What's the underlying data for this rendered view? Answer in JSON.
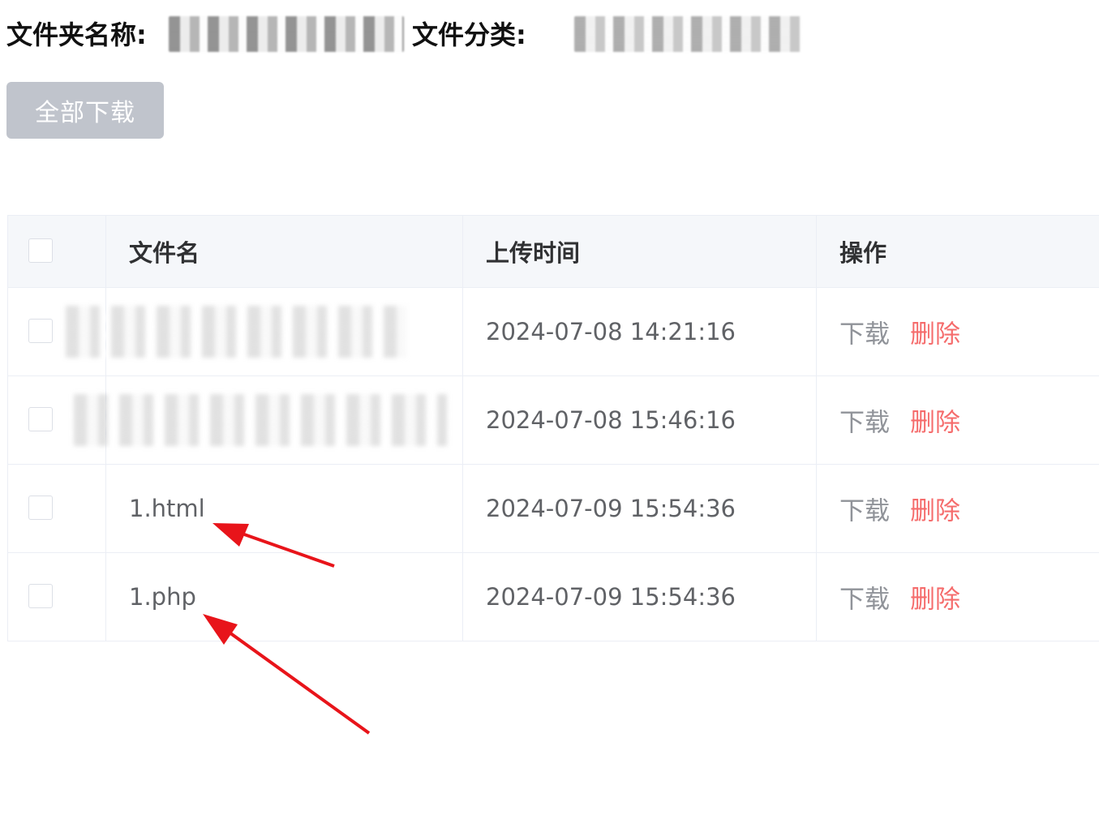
{
  "header": {
    "folder_label": "文件夹名称:",
    "category_label": "文件分类:"
  },
  "toolbar": {
    "download_all_label": "全部下载"
  },
  "table": {
    "columns": [
      "",
      "文件名",
      "上传时间",
      "操作"
    ],
    "rows": [
      {
        "file_name": "",
        "upload_time": "2024-07-08 14:21:16",
        "download_label": "下载",
        "delete_label": "删除",
        "name_redacted": true
      },
      {
        "file_name": "",
        "upload_time": "2024-07-08 15:46:16",
        "download_label": "下载",
        "delete_label": "删除",
        "name_redacted": true
      },
      {
        "file_name": "1.html",
        "upload_time": "2024-07-09 15:54:36",
        "download_label": "下载",
        "delete_label": "删除"
      },
      {
        "file_name": "1.php",
        "upload_time": "2024-07-09 15:54:36",
        "download_label": "下载",
        "delete_label": "删除"
      }
    ]
  },
  "colors": {
    "disabled_button": "#c0c4cc",
    "header_bg": "#f5f7fa",
    "border": "#ebeef5",
    "delete_link": "#f56c6c",
    "download_link": "#909399",
    "annotation_arrow": "#e8141a"
  }
}
